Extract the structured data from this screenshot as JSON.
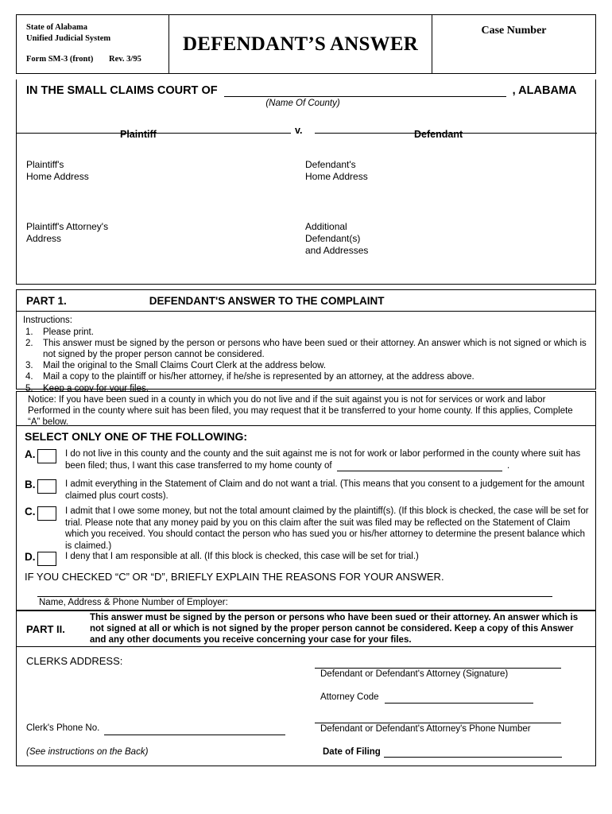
{
  "header": {
    "state": "State of Alabama",
    "system": "Unified Judicial System",
    "form_number": "Form SM-3 (front)",
    "revision": "Rev. 3/95",
    "title": "DEFENDANT’S ANSWER",
    "case_number_label": "Case Number"
  },
  "caption": {
    "court_prefix": "IN THE SMALL CLAIMS COURT OF",
    "state_suffix": ", ALABAMA",
    "county_caption": "(Name Of County)",
    "vs": "v.",
    "plaintiff_label": "Plaintiff",
    "defendant_label": "Defendant",
    "plaintiff_home_line1": "Plaintiff's",
    "plaintiff_home_line2": "Home Address",
    "defendant_home_line1": "Defendant's",
    "defendant_home_line2": "Home Address",
    "plaintiff_attorney_line1": "Plaintiff's Attorney's",
    "plaintiff_attorney_line2": "Address",
    "additional_defendants_line1": "Additional",
    "additional_defendants_line2": "Defendant(s)",
    "additional_defendants_line3": "and Addresses"
  },
  "part1": {
    "label": "PART 1.",
    "title": "DEFENDANT'S ANSWER TO THE COMPLAINT",
    "instructions_heading": "Instructions:",
    "instructions": [
      {
        "num": "1.",
        "text": "Please print."
      },
      {
        "num": "2.",
        "text": "This answer must be signed by the person or persons who have been sued or their attorney.  An answer which is not signed or which is not signed by the proper person cannot be considered."
      },
      {
        "num": "3.",
        "text": "Mail the original to the Small Claims Court Clerk at the address below."
      },
      {
        "num": "4.",
        "text": "Mail a copy to the plaintiff or his/her attorney, if he/she is represented by an attorney, at the address above."
      },
      {
        "num": "5.",
        "text": "Keep a copy for your files."
      }
    ],
    "notice": "Notice:  If you have been sued in a county in which you do not live and if the suit against you is not for services or work and labor Performed in the county where suit has been filed, you may request that it be transferred to your home county.  If this applies, Complete “A” below."
  },
  "select": {
    "heading": "SELECT ONLY ONE OF THE FOLLOWING:",
    "options": [
      {
        "letter": "A.",
        "text_before_blank": "I do not live in this county and the county and the suit against me is not for work or labor performed in the county where suit has been filed; thus, I want this case transferred to my home county of",
        "text_after_blank": "."
      },
      {
        "letter": "B.",
        "text": "I admit everything in the Statement of Claim and do not want a trial.  (This means that you consent to a judgement for the amount claimed plus court costs)."
      },
      {
        "letter": "C.",
        "text": "I admit that I owe some money, but not the total amount claimed by the plaintiff(s).  (If this block is checked, the case will be set for trial.  Please note that any money paid by you on this claim after the suit was filed may be reflected on the Statement of Claim which you received.  You should contact the person who has sued you or his/her attorney to determine the present balance which is claimed.)"
      },
      {
        "letter": "D.",
        "text": "I deny that I am responsible at all.  (If this block is checked, this case will be set for trial.)"
      }
    ],
    "explain_line": "IF YOU CHECKED “C” OR “D”, BRIEFLY EXPLAIN THE REASONS FOR YOUR ANSWER.",
    "employer_label": "Name, Address & Phone Number of Employer:"
  },
  "part2": {
    "label": "PART II.",
    "text": "This answer must be signed by the person or persons who have been sued or their attorney.  An answer which is not signed at all or which is not signed by the proper person cannot be considered.  Keep a copy of this Answer and any other documents you receive concerning your case for your files."
  },
  "signature": {
    "clerks_address_label": "CLERKS ADDRESS:",
    "clerk_phone_label": "Clerk's Phone No.",
    "see_instructions": "(See instructions on the Back)",
    "signature_label": "Defendant or Defendant's Attorney (Signature)",
    "attorney_code_label": "Attorney Code",
    "phone_label": "Defendant or Defendant's Attorney's Phone Number",
    "date_of_filing_label": "Date of Filing"
  }
}
